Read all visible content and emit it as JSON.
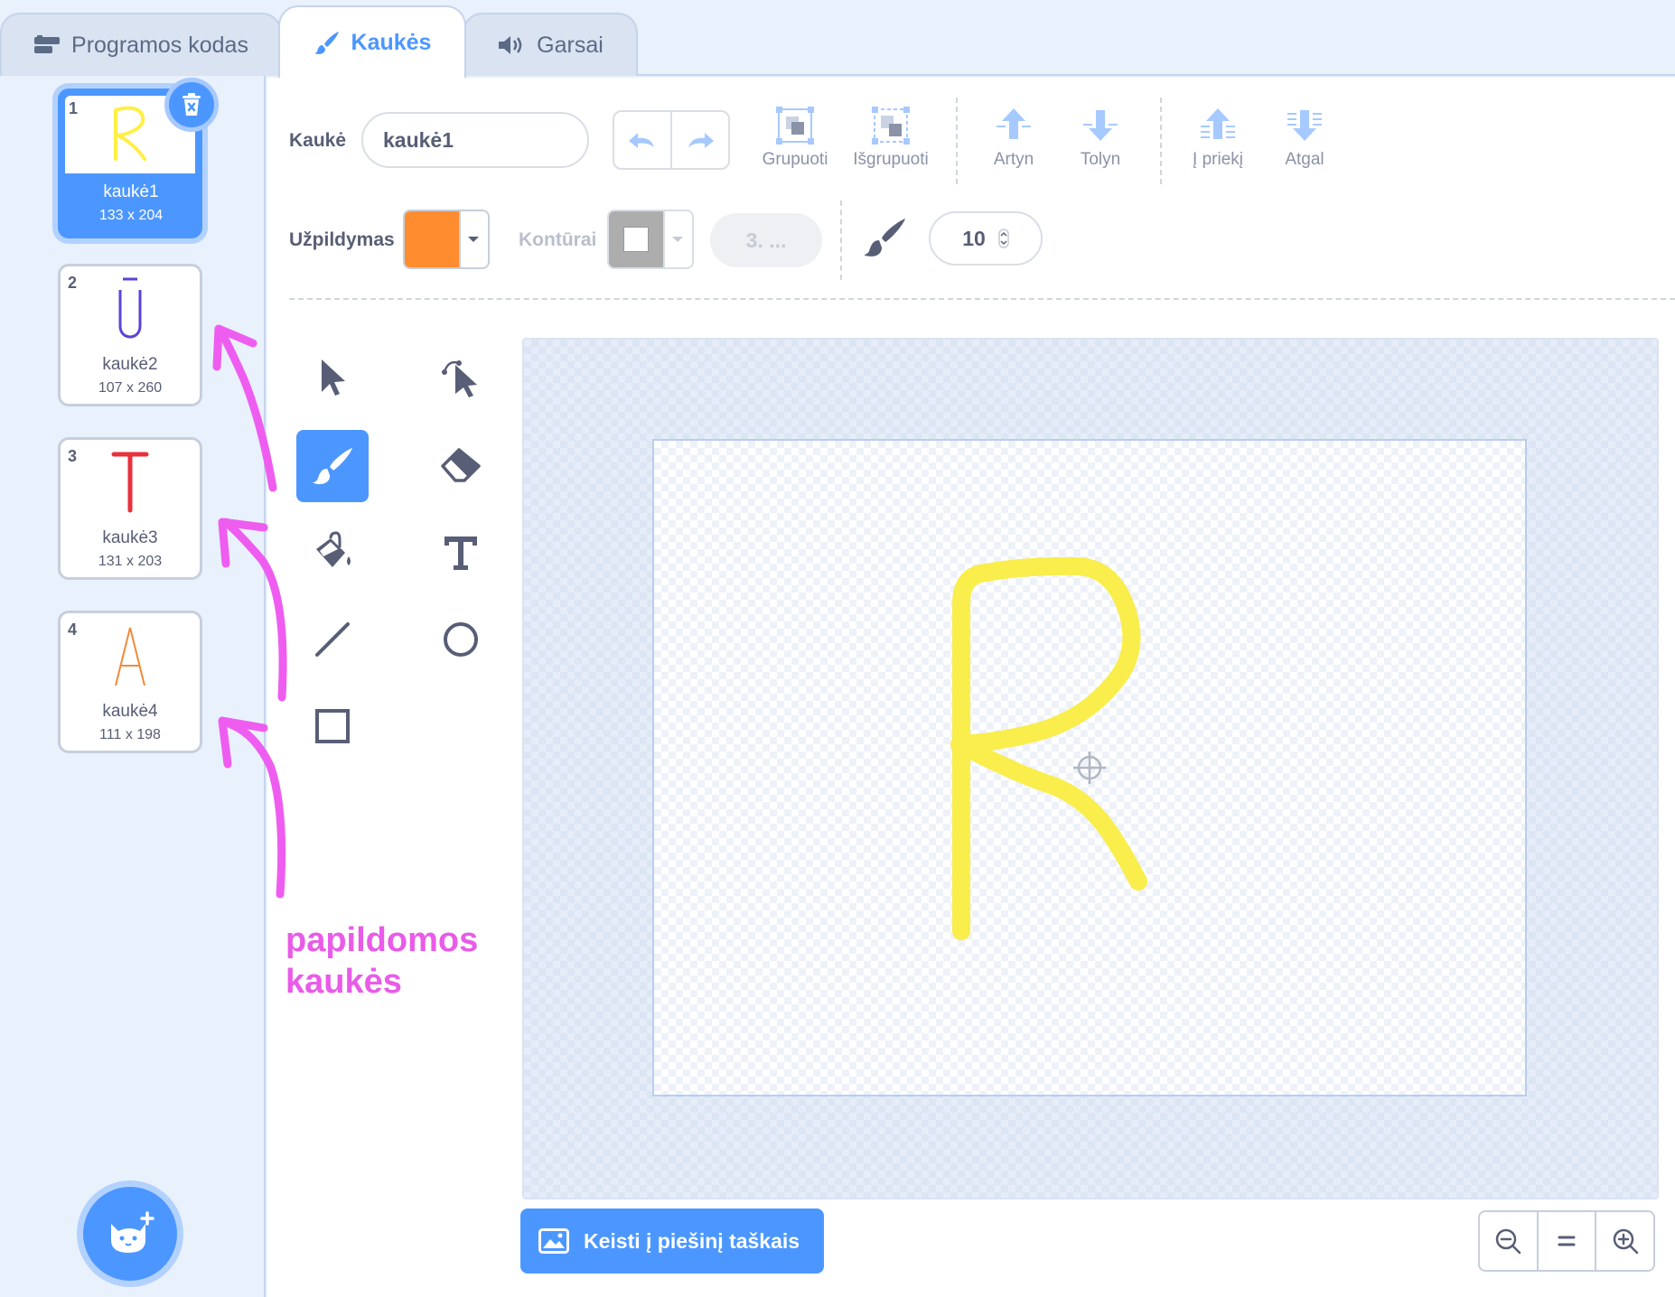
{
  "tabs": [
    {
      "label": "Programos kodas",
      "icon": "code-icon",
      "active": false
    },
    {
      "label": "Kaukės",
      "icon": "brush-icon",
      "active": true
    },
    {
      "label": "Garsai",
      "icon": "speaker-icon",
      "active": false
    }
  ],
  "costumes": [
    {
      "num": "1",
      "name": "kaukė1",
      "size": "133 x 204",
      "glyph": "R",
      "color": "#ffef47",
      "selected": true
    },
    {
      "num": "2",
      "name": "kaukė2",
      "size": "107 x 260",
      "glyph": "Ū",
      "color": "#5b43d6",
      "selected": false
    },
    {
      "num": "3",
      "name": "kaukė3",
      "size": "131 x 203",
      "glyph": "T",
      "color": "#e8323c",
      "selected": false
    },
    {
      "num": "4",
      "name": "kaukė4",
      "size": "111 x 198",
      "glyph": "A",
      "color": "#f08a3b",
      "selected": false
    }
  ],
  "toolbar": {
    "costume_label": "Kaukė",
    "costume_name": "kaukė1",
    "group": "Grupuoti",
    "ungroup": "Išgrupuoti",
    "forward": "Artyn",
    "backward": "Tolyn",
    "front": "Į priekį",
    "back": "Atgal",
    "fill_label": "Užpildymas",
    "fill_color": "#ff8c2e",
    "outline_label": "Kontūrai",
    "outline_width": "3. ...",
    "brush_size": "10"
  },
  "tools": [
    "select-icon",
    "reshape-icon",
    "brush-icon",
    "eraser-icon",
    "fill-icon",
    "text-icon",
    "line-icon",
    "circle-icon",
    "rectangle-icon"
  ],
  "active_tool": "brush-icon",
  "bitmap_button": "Keisti į piešinį taškais",
  "zoom": [
    "zoom-out-icon",
    "zoom-reset-icon",
    "zoom-in-icon"
  ],
  "annotation": {
    "line1": "papildomos",
    "line2": "kaukės",
    "color": "#e95be8"
  },
  "colors": {
    "accent": "#4c97ff",
    "text": "#575e75"
  }
}
